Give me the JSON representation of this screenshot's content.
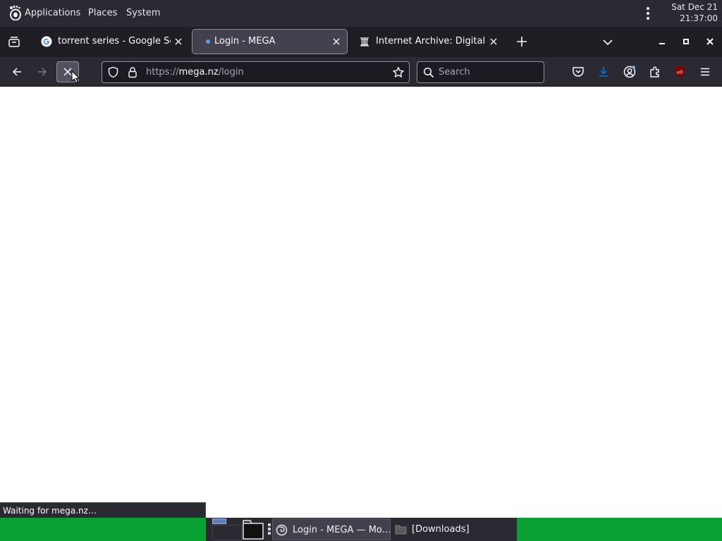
{
  "top_panel": {
    "menus": {
      "applications": "Applications",
      "places": "Places",
      "system": "System"
    },
    "clock": {
      "date": "Sat Dec 21",
      "time": "21:37:00"
    }
  },
  "browser": {
    "tabs": [
      {
        "title": "torrent series - Google Search",
        "favicon": "google-icon",
        "active": false
      },
      {
        "title": "Login - MEGA",
        "favicon": "loading-dot-icon",
        "active": true
      },
      {
        "title": "Internet Archive: Digital Library",
        "favicon": "archive-icon",
        "active": false
      }
    ],
    "url": {
      "scheme": "https://",
      "host": "mega.nz",
      "path": "/login"
    },
    "search": {
      "placeholder": "Search",
      "value": ""
    },
    "status_text": "Waiting for mega.nz…",
    "colors": {
      "toolbar": "#2b2a33",
      "tabstrip": "#1f1e25",
      "download_accent": "#0b6bd6",
      "ublock": "#800000"
    }
  },
  "taskbar": {
    "tasks": [
      {
        "label": "Login - MEGA — Mozilla Firefox",
        "display": "Login - MEGA — Mo…",
        "icon": "firefox-icon"
      },
      {
        "label": "[Downloads]",
        "icon": "folder-icon"
      }
    ],
    "colors": {
      "panel": "#07a132"
    }
  }
}
